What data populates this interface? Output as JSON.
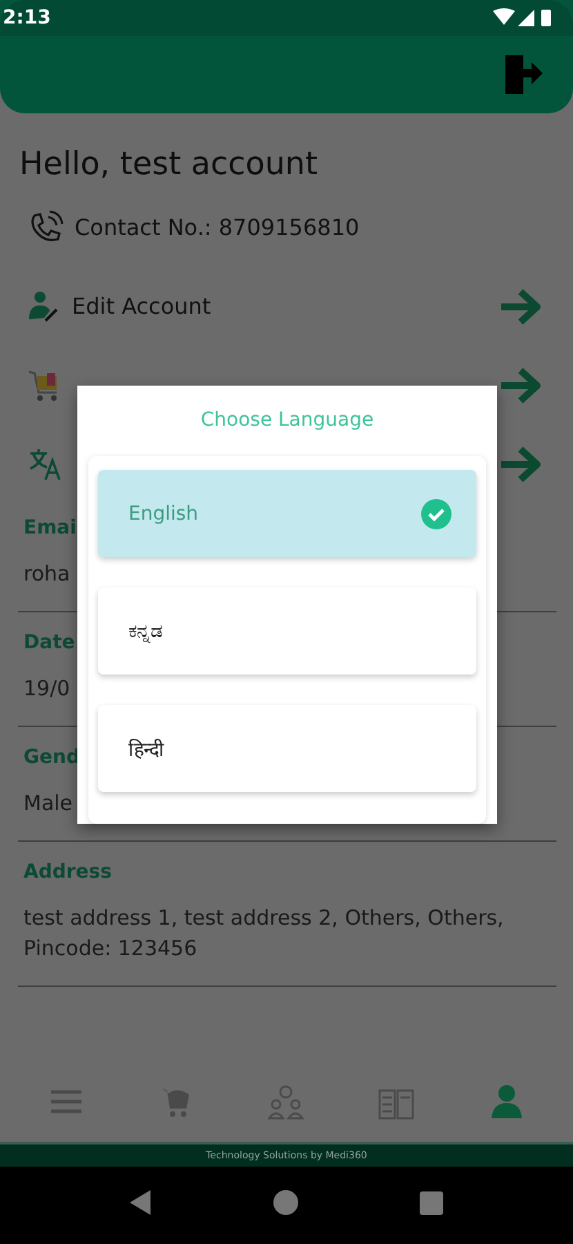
{
  "status_bar": {
    "time": "2:13"
  },
  "greeting": "Hello, test  account",
  "menu": [
    {
      "kind": "info",
      "label": "Contact No.: 8709156810"
    },
    {
      "kind": "link",
      "label": "Edit Account"
    },
    {
      "kind": "link"
    },
    {
      "kind": "link"
    }
  ],
  "fields": [
    {
      "label": "Emai",
      "value": "roha"
    },
    {
      "label": "Date",
      "value": "19/0"
    },
    {
      "label": "Gend",
      "value": "Male"
    },
    {
      "label": "Address",
      "value": "test address 1, test address 2, Others, Others, Pincode: 123456"
    }
  ],
  "bottom_nav": [
    {
      "selected": false
    },
    {
      "selected": false
    },
    {
      "selected": false
    },
    {
      "selected": false
    },
    {
      "selected": true
    }
  ],
  "footer": "Technology Solutions by Medi360",
  "dialog": {
    "title": "Choose Language",
    "options": [
      {
        "label": "English",
        "selected": true
      },
      {
        "label": "ಕನ್ನಡ",
        "selected": false
      },
      {
        "label": "हिन्दी",
        "selected": false
      }
    ]
  }
}
